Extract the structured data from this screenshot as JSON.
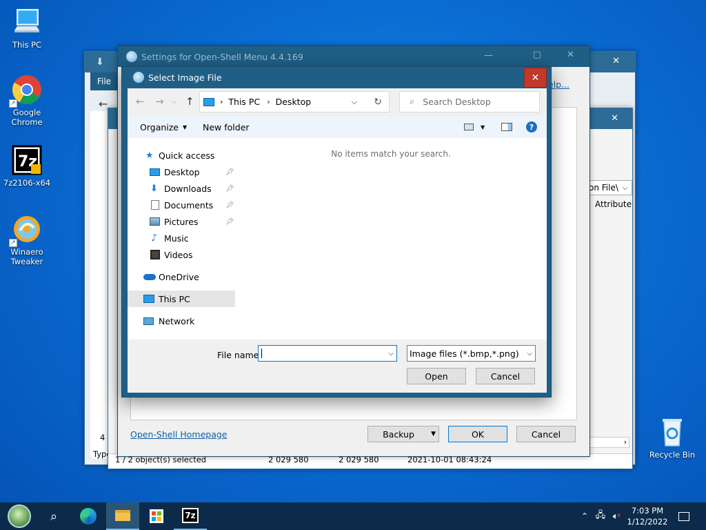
{
  "desktop": {
    "icons": [
      {
        "name": "this-pc",
        "label": "This PC"
      },
      {
        "name": "google-chrome",
        "label_line1": "Google",
        "label_line2": "Chrome"
      },
      {
        "name": "7zip-installer",
        "label": "7z2106-x64"
      },
      {
        "name": "winaero-tweaker",
        "label_line1": "Winaero",
        "label_line2": "Tweaker"
      },
      {
        "name": "recycle-bin",
        "label": "Recycle Bin"
      }
    ]
  },
  "settings_window": {
    "title": "Settings for Open-Shell Menu 4.4.169",
    "help_link": "elp...",
    "homepage_link": "Open-Shell Homepage",
    "backup_label": "Backup",
    "ok_label": "OK",
    "cancel_label": "Cancel"
  },
  "background_window": {
    "file_tab": "File",
    "column_partial": "on File\\",
    "attribute_header": "Attribute",
    "count_partial": "4 i",
    "type_partial": "Type",
    "status": "1 / 2 object(s) selected",
    "size1": "2 029 580",
    "size2": "2 029 580",
    "timestamp": "2021-10-01 08:43:24"
  },
  "dialog": {
    "title": "Select Image File",
    "address": {
      "part1": "This PC",
      "part2": "Desktop"
    },
    "search_placeholder": "Search Desktop",
    "organize_label": "Organize",
    "new_folder_label": "New folder",
    "empty_message": "No items match your search.",
    "nav": {
      "quick_access": "Quick access",
      "desktop": "Desktop",
      "downloads": "Downloads",
      "documents": "Documents",
      "pictures": "Pictures",
      "music": "Music",
      "videos": "Videos",
      "onedrive": "OneDrive",
      "this_pc": "This PC",
      "network": "Network"
    },
    "file_name_label": "File name:",
    "file_name_value": "",
    "file_type_value": "Image files (*.bmp,*.png)",
    "open_label": "Open",
    "cancel_label": "Cancel"
  },
  "taskbar": {
    "time": "7:03 PM",
    "date": "1/12/2022",
    "sevenzip_label": "7z"
  },
  "colors": {
    "accent": "#1f5f86",
    "close_red": "#c0392b",
    "taskbar": "#0c2b4a",
    "selected_nav": "#e5e5e5"
  }
}
